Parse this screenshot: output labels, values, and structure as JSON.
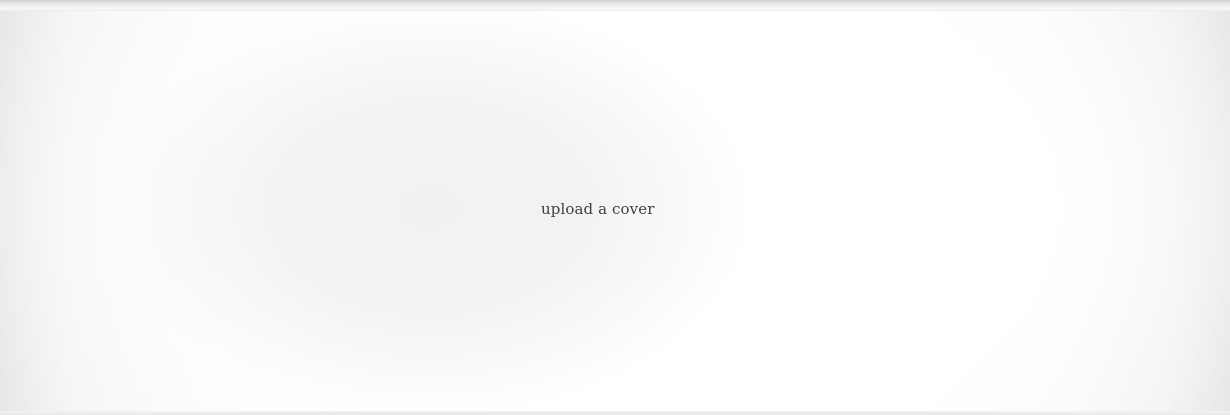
{
  "cover": {
    "upload_label": "upload a cover"
  },
  "colors": {
    "label_text": "#404040",
    "background": "#ffffff",
    "edge_shade": "#d4d4d4"
  }
}
